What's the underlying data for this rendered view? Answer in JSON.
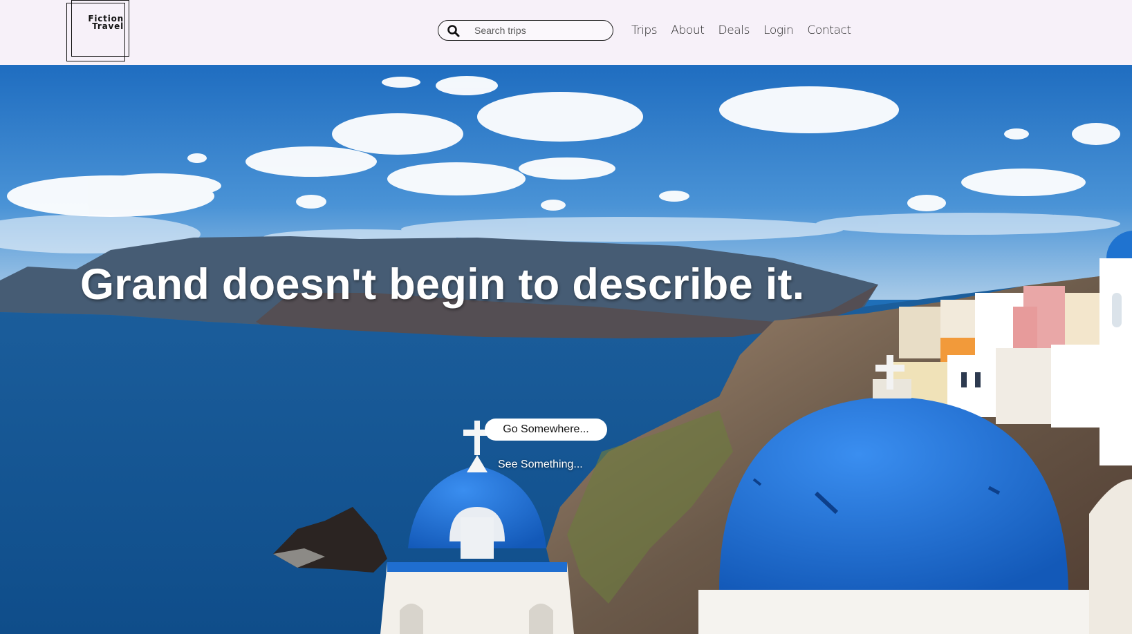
{
  "logo": {
    "line1": "Fiction",
    "line2": "Travel"
  },
  "search": {
    "placeholder": "Search trips",
    "value": "",
    "icon": "search-icon"
  },
  "nav": {
    "items": [
      {
        "label": "Trips"
      },
      {
        "label": "About"
      },
      {
        "label": "Deals"
      },
      {
        "label": "Login"
      },
      {
        "label": "Contact"
      }
    ]
  },
  "hero": {
    "headline": "Grand doesn't begin to describe it.",
    "primary_cta": "Go Somewhere...",
    "secondary_cta": "See Something..."
  },
  "colors": {
    "header_bg": "#f7f1f9",
    "sky": "#2b7fc9",
    "sea": "#1a5f9e",
    "dome_blue": "#1f73d0",
    "cta_bg": "#ffffff"
  }
}
